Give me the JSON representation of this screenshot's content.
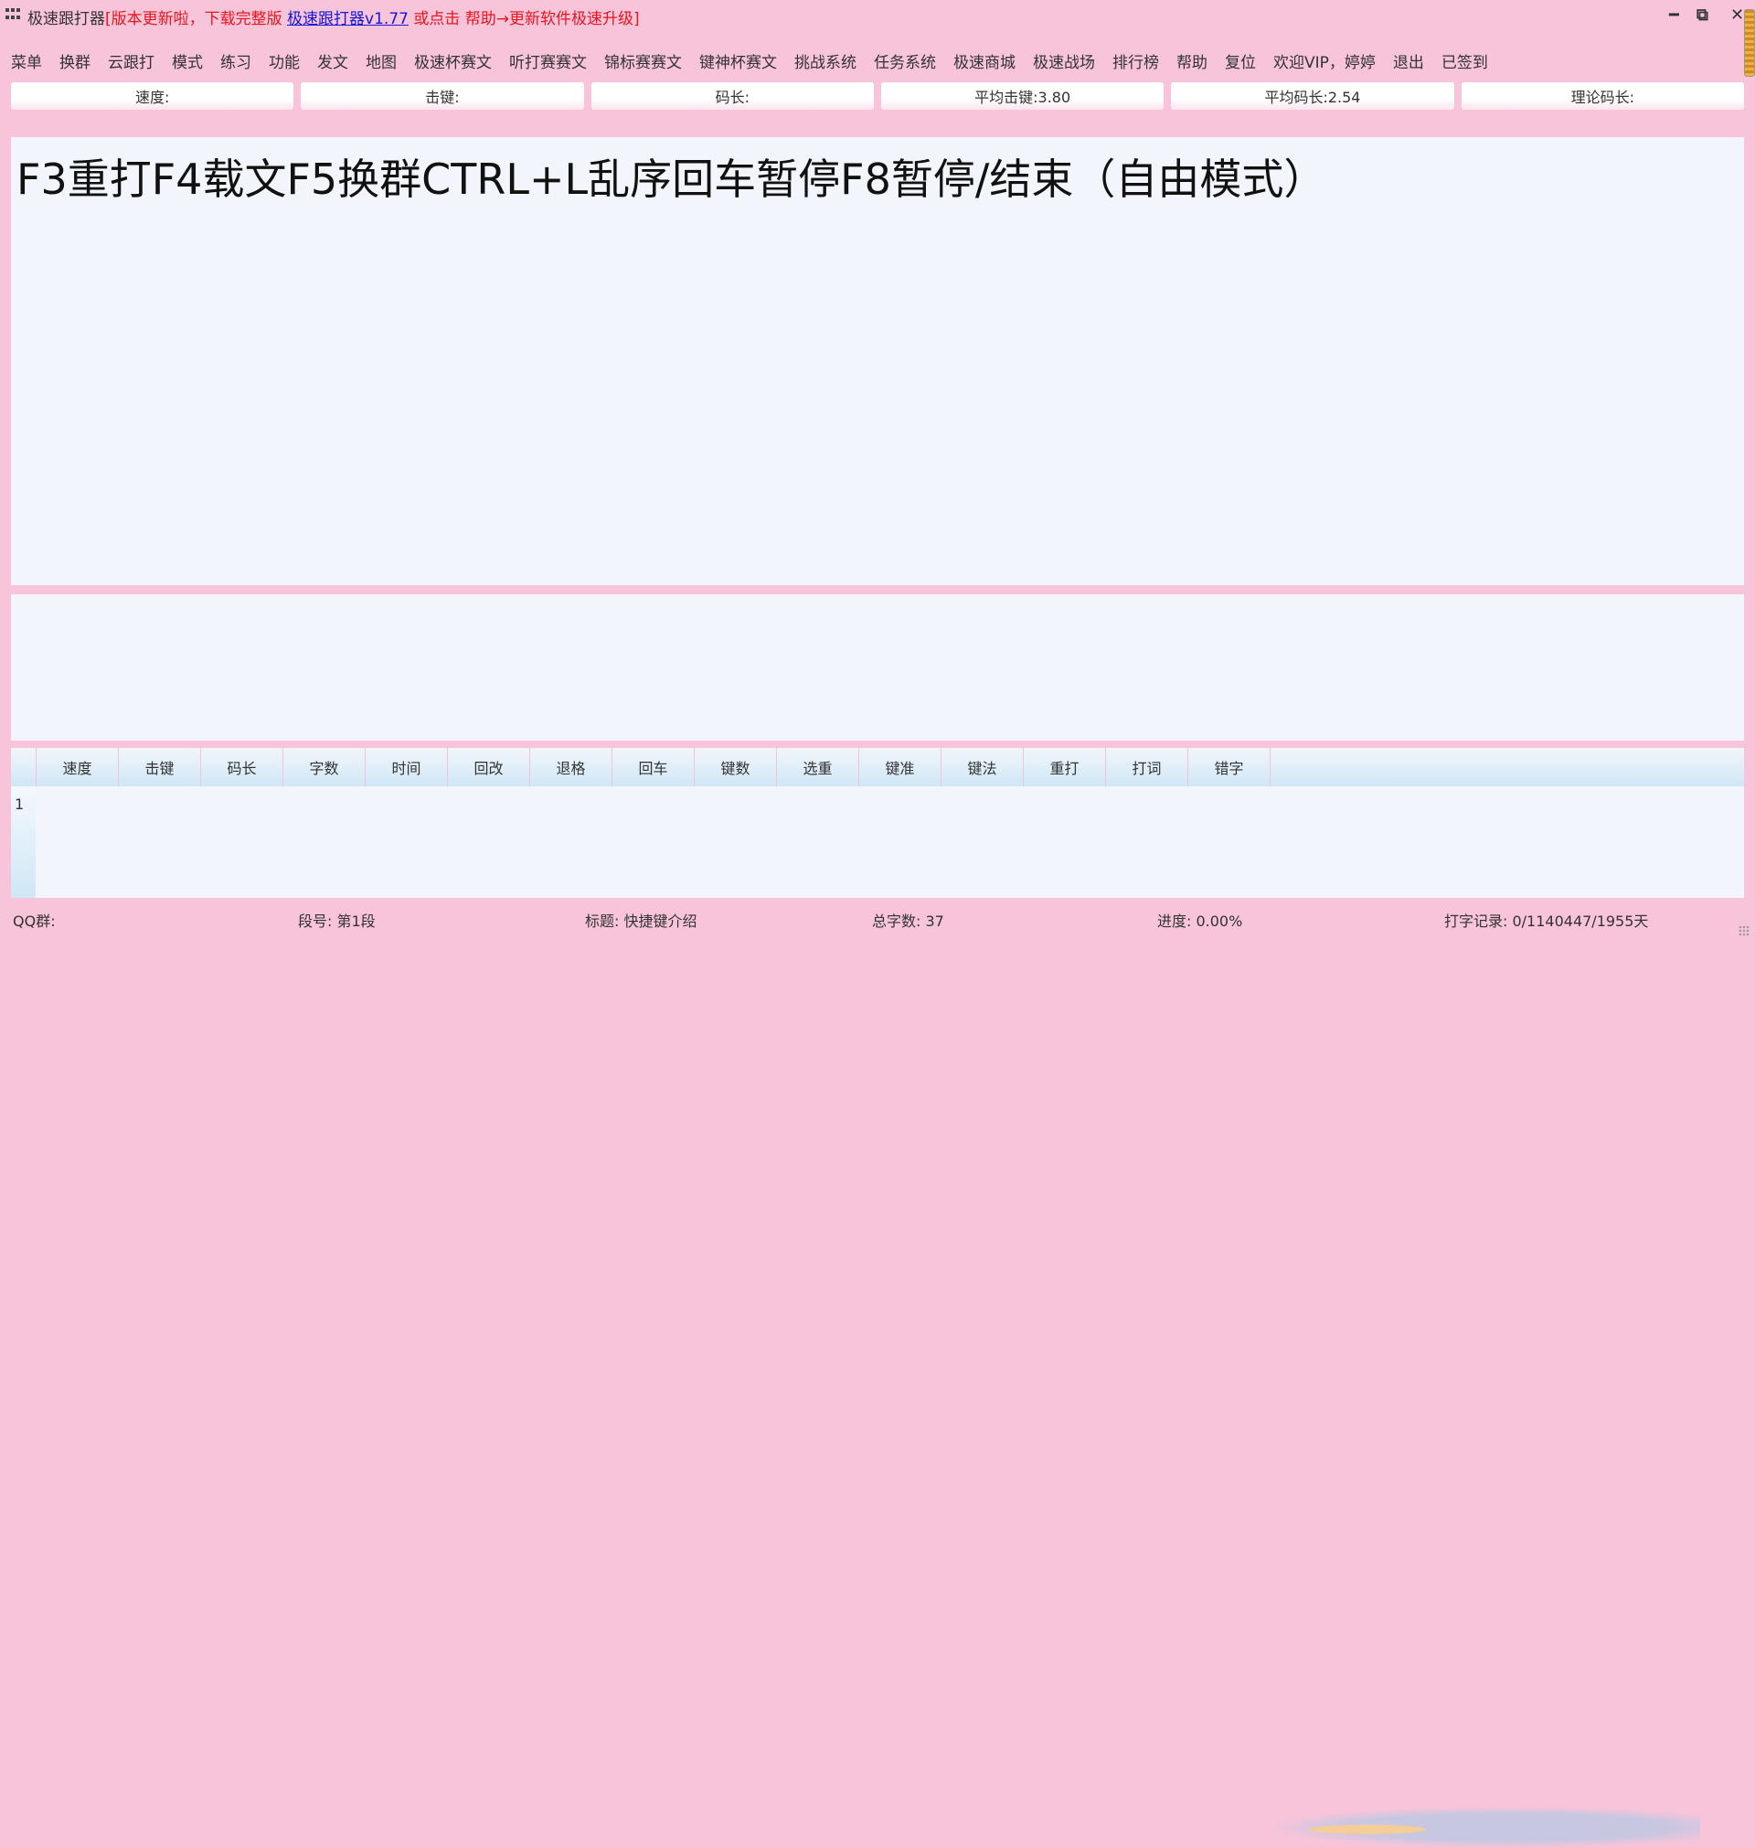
{
  "window": {
    "app_name": "极速跟打器",
    "notice_open": "[",
    "notice_text": "版本更新啦，下载完整版 ",
    "notice_link": "极速跟打器v1.77",
    "notice_tail": " 或点击 帮助→更新软件极速升级",
    "notice_close": "]",
    "minimize_symbol": "━",
    "restore_symbol": "⧉",
    "close_symbol": "✕"
  },
  "menu": [
    "菜单",
    "换群",
    "云跟打",
    "模式",
    "练习",
    "功能",
    "发文",
    "地图",
    "极速杯赛文",
    "听打赛赛文",
    "锦标赛赛文",
    "键神杯赛文",
    "挑战系统",
    "任务系统",
    "极速商城",
    "极速战场",
    "排行榜",
    "帮助",
    "复位",
    "欢迎VIP，婷婷",
    "退出",
    "已签到"
  ],
  "stats": {
    "speed": "速度:",
    "keystroke": "击键:",
    "code_length": "码长:",
    "avg_keystroke": "平均击键:3.80",
    "avg_code_length": "平均码长:2.54",
    "theory_code_length": "理论码长:"
  },
  "sample_text": "F3重打F4载文F5换群CTRL+L乱序回车暂停F8暂停/结束（自由模式）",
  "input_text": "",
  "results": {
    "columns": [
      "速度",
      "击键",
      "码长",
      "字数",
      "时间",
      "回改",
      "退格",
      "回车",
      "键数",
      "选重",
      "键准",
      "键法",
      "重打",
      "打词",
      "错字"
    ],
    "rows": [
      "1"
    ]
  },
  "status": {
    "qq_group": "QQ群:",
    "segment": "段号: 第1段",
    "title": "标题: 快捷键介绍",
    "total_chars": "总字数: 37",
    "progress": "进度: 0.00%",
    "record": "打字记录: 0/1140447/1955天"
  },
  "colors": {
    "background": "#f7c4d9",
    "panel": "#f2f5fb",
    "notice_red": "#e8141e",
    "link_blue": "#1717d8"
  },
  "icons": [
    "app-grid-icon",
    "minimize-icon",
    "restore-icon",
    "close-icon",
    "resize-grip-icon"
  ]
}
